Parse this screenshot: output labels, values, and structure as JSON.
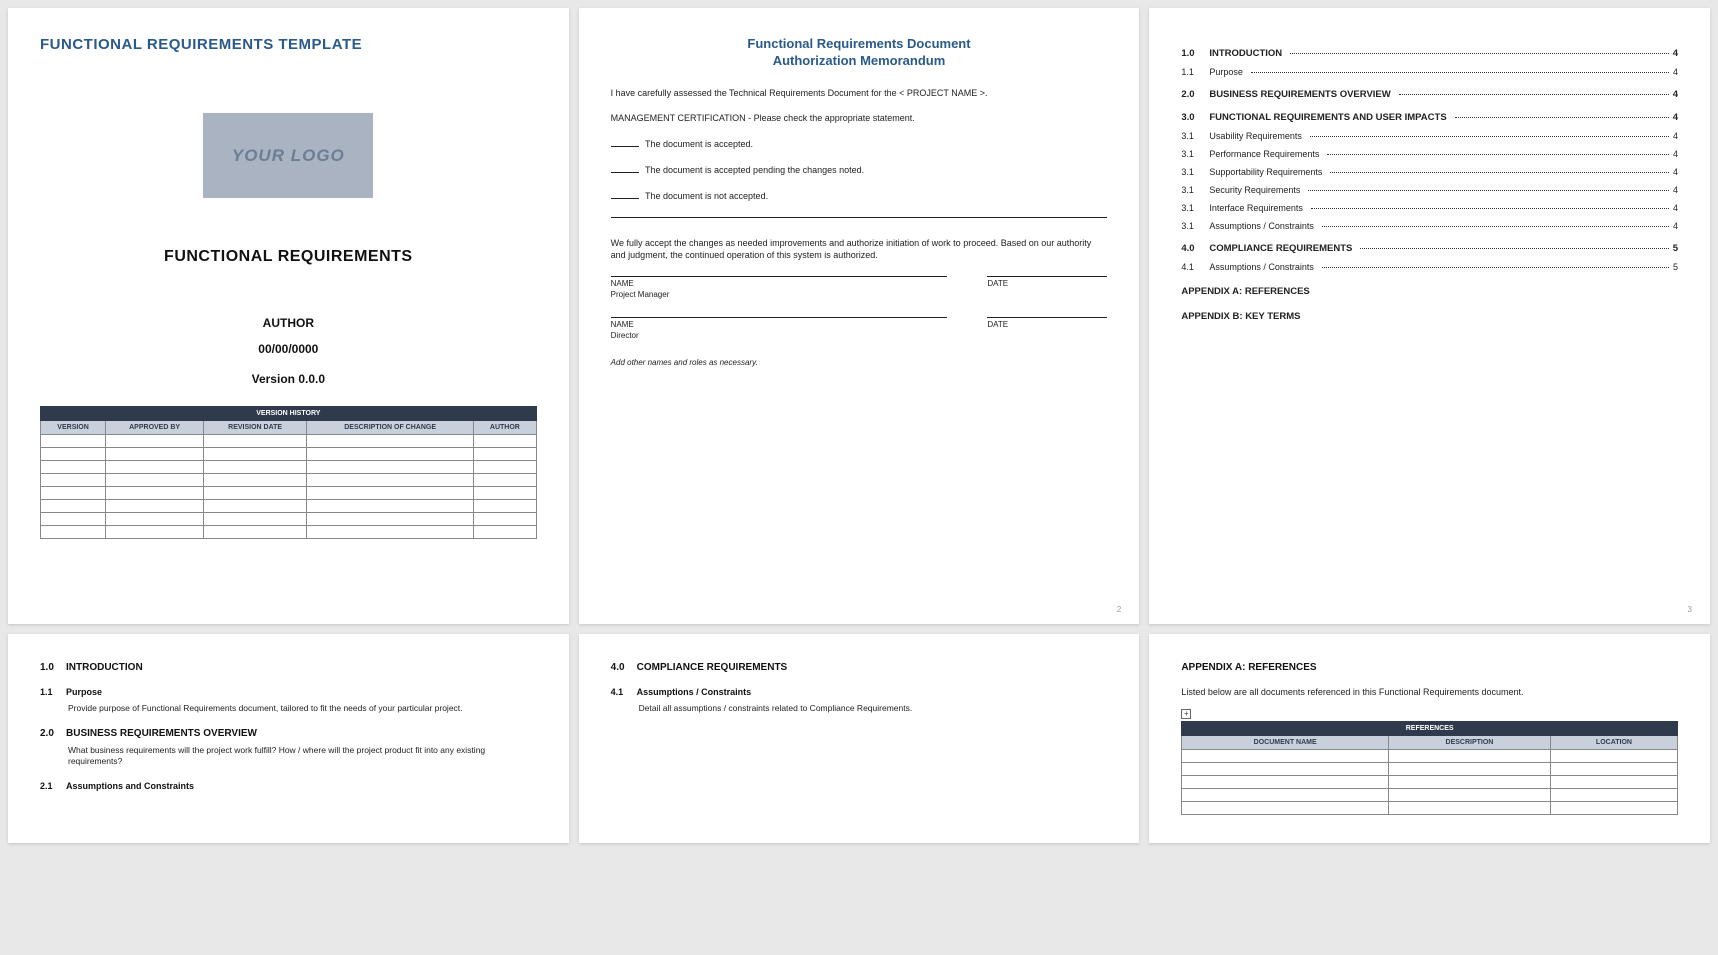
{
  "page1": {
    "template_title": "FUNCTIONAL REQUIREMENTS TEMPLATE",
    "logo_text": "YOUR LOGO",
    "doc_title": "FUNCTIONAL REQUIREMENTS",
    "author_label": "AUTHOR",
    "date_label": "00/00/0000",
    "version_label": "Version 0.0.0",
    "vh_title": "VERSION HISTORY",
    "vh_cols": [
      "VERSION",
      "APPROVED BY",
      "REVISION DATE",
      "DESCRIPTION OF CHANGE",
      "AUTHOR"
    ]
  },
  "page2": {
    "title_line1": "Functional Requirements Document",
    "title_line2": "Authorization Memorandum",
    "intro": "I have carefully assessed the Technical Requirements Document for the < PROJECT NAME >.",
    "mgmt_cert": "MANAGEMENT CERTIFICATION - Please check the appropriate statement.",
    "opt1": "The document is accepted.",
    "opt2": "The document is accepted pending the changes noted.",
    "opt3": "The document is not accepted.",
    "accept_text": "We fully accept the changes as needed improvements and authorize initiation of work to proceed. Based on our authority and judgment, the continued operation of this system is authorized.",
    "name_label": "NAME",
    "date_label": "DATE",
    "role1": "Project Manager",
    "role2": "Director",
    "add_note": "Add other names and roles as necessary.",
    "pagenum": "2"
  },
  "page3": {
    "toc": [
      {
        "num": "1.0",
        "label": "INTRODUCTION",
        "page": "4",
        "bold": true
      },
      {
        "num": "1.1",
        "label": "Purpose",
        "page": "4",
        "bold": false
      },
      {
        "num": "2.0",
        "label": "BUSINESS REQUIREMENTS OVERVIEW",
        "page": "4",
        "bold": true
      },
      {
        "num": "3.0",
        "label": "FUNCTIONAL REQUIREMENTS AND USER IMPACTS",
        "page": "4",
        "bold": true
      },
      {
        "num": "3.1",
        "label": "Usability Requirements",
        "page": "4",
        "bold": false
      },
      {
        "num": "3.1",
        "label": "Performance Requirements",
        "page": "4",
        "bold": false
      },
      {
        "num": "3.1",
        "label": "Supportability Requirements",
        "page": "4",
        "bold": false
      },
      {
        "num": "3.1",
        "label": "Security Requirements",
        "page": "4",
        "bold": false
      },
      {
        "num": "3.1",
        "label": "Interface Requirements",
        "page": "4",
        "bold": false
      },
      {
        "num": "3.1",
        "label": "Assumptions / Constraints",
        "page": "4",
        "bold": false
      },
      {
        "num": "4.0",
        "label": "COMPLIANCE REQUIREMENTS",
        "page": "5",
        "bold": true
      },
      {
        "num": "4.1",
        "label": "Assumptions / Constraints",
        "page": "5",
        "bold": false
      }
    ],
    "appendix_a": "APPENDIX A: REFERENCES",
    "appendix_b": "APPENDIX B: KEY TERMS",
    "pagenum": "3"
  },
  "page4": {
    "s1_num": "1.0",
    "s1_title": "INTRODUCTION",
    "s11_num": "1.1",
    "s11_title": "Purpose",
    "s11_body": "Provide purpose of Functional Requirements document, tailored to fit the needs of your particular project.",
    "s2_num": "2.0",
    "s2_title": "BUSINESS REQUIREMENTS OVERVIEW",
    "s2_body": "What business requirements will the project work fulfill?  How / where will the project product fit into any existing requirements?",
    "s21_num": "2.1",
    "s21_title": "Assumptions and Constraints"
  },
  "page5": {
    "s4_num": "4.0",
    "s4_title": "COMPLIANCE REQUIREMENTS",
    "s41_num": "4.1",
    "s41_title": "Assumptions / Constraints",
    "s41_body": "Detail all assumptions / constraints related to Compliance Requirements."
  },
  "page6": {
    "title": "APPENDIX A: REFERENCES",
    "note": "Listed below are all documents referenced in this Functional Requirements document.",
    "ref_title": "REFERENCES",
    "ref_cols": [
      "DOCUMENT NAME",
      "DESCRIPTION",
      "LOCATION"
    ]
  }
}
